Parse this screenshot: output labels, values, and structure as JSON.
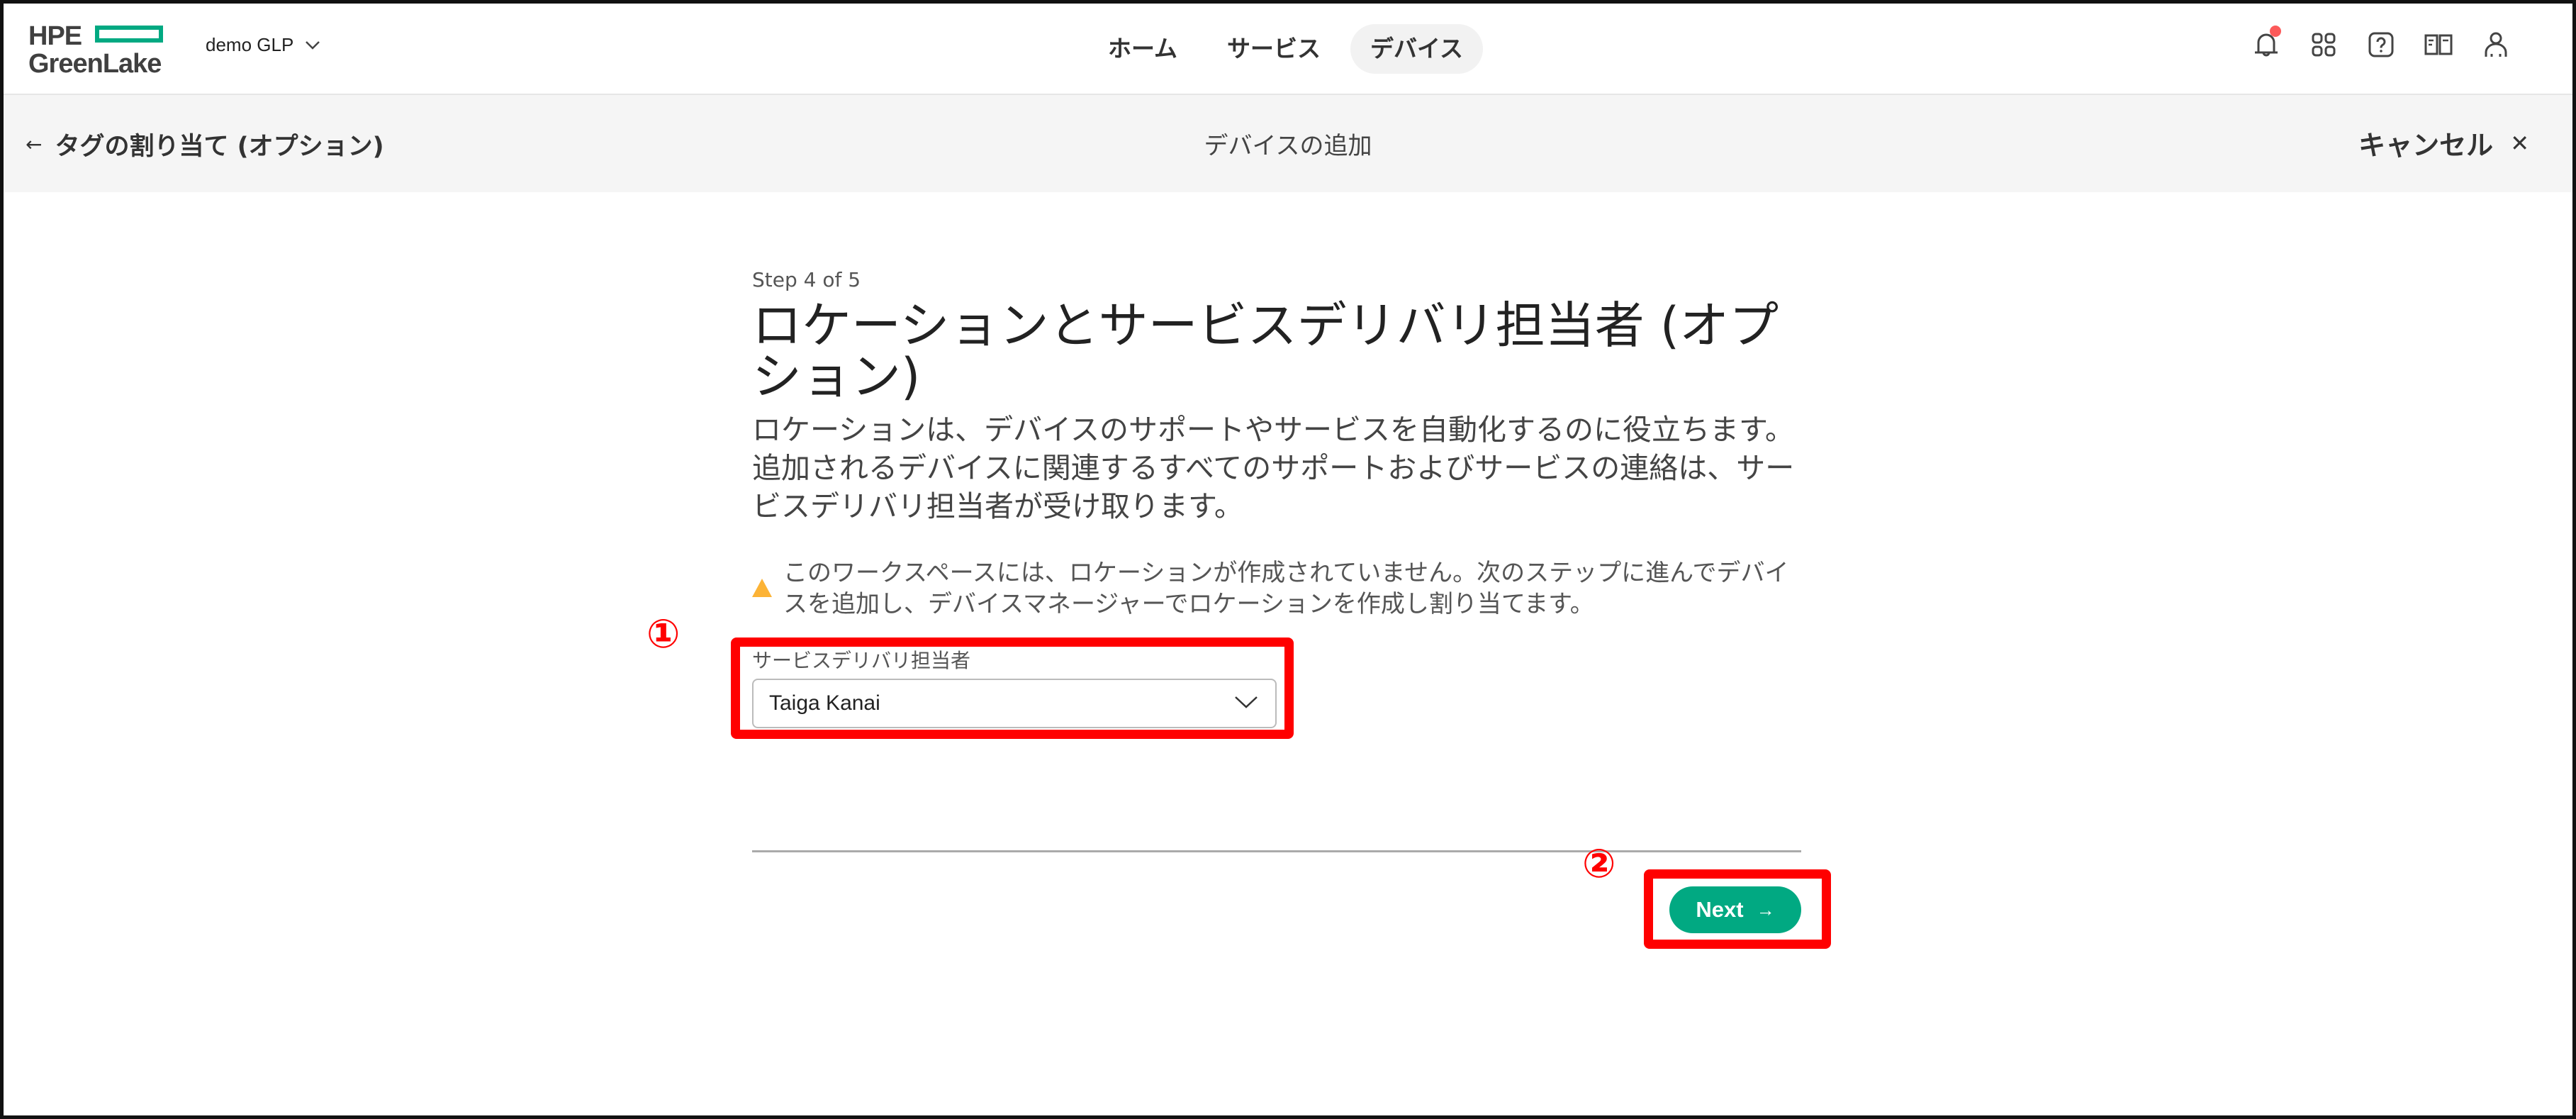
{
  "header": {
    "logo_top": "HPE",
    "logo_bottom": "GreenLake",
    "workspace": "demo GLP",
    "nav": [
      {
        "label": "ホーム",
        "active": false
      },
      {
        "label": "サービス",
        "active": false
      },
      {
        "label": "デバイス",
        "active": true
      }
    ],
    "icons": [
      "bell-icon",
      "apps-grid-icon",
      "help-icon",
      "book-icon",
      "user-icon"
    ],
    "notification_dot_color": "#fc5a5a"
  },
  "subheader": {
    "back_label": "タグの割り当て (オプション)",
    "title": "デバイスの追加",
    "cancel_label": "キャンセル"
  },
  "main": {
    "step": "Step 4 of 5",
    "title": "ロケーションとサービスデリバリ担当者 (オプション)",
    "description": "ロケーションは、デバイスのサポートやサービスを自動化するのに役立ちます。追加されるデバイスに関連するすべてのサポートおよびサービスの連絡は、サービスデリバリ担当者が受け取ります。",
    "warning": "このワークスペースには、ロケーションが作成されていません。次のステップに進んでデバイスを追加し、デバイスマネージャーでロケーションを作成し割り当てます。",
    "field_label": "サービスデリバリ担当者",
    "field_value": "Taiga Kanai",
    "next_label": "Next"
  },
  "annotations": {
    "marker_1": "①",
    "marker_2": "②"
  },
  "colors": {
    "brand_green": "#01a982",
    "warning": "#fcb336",
    "annotation_red": "#ff0000"
  }
}
